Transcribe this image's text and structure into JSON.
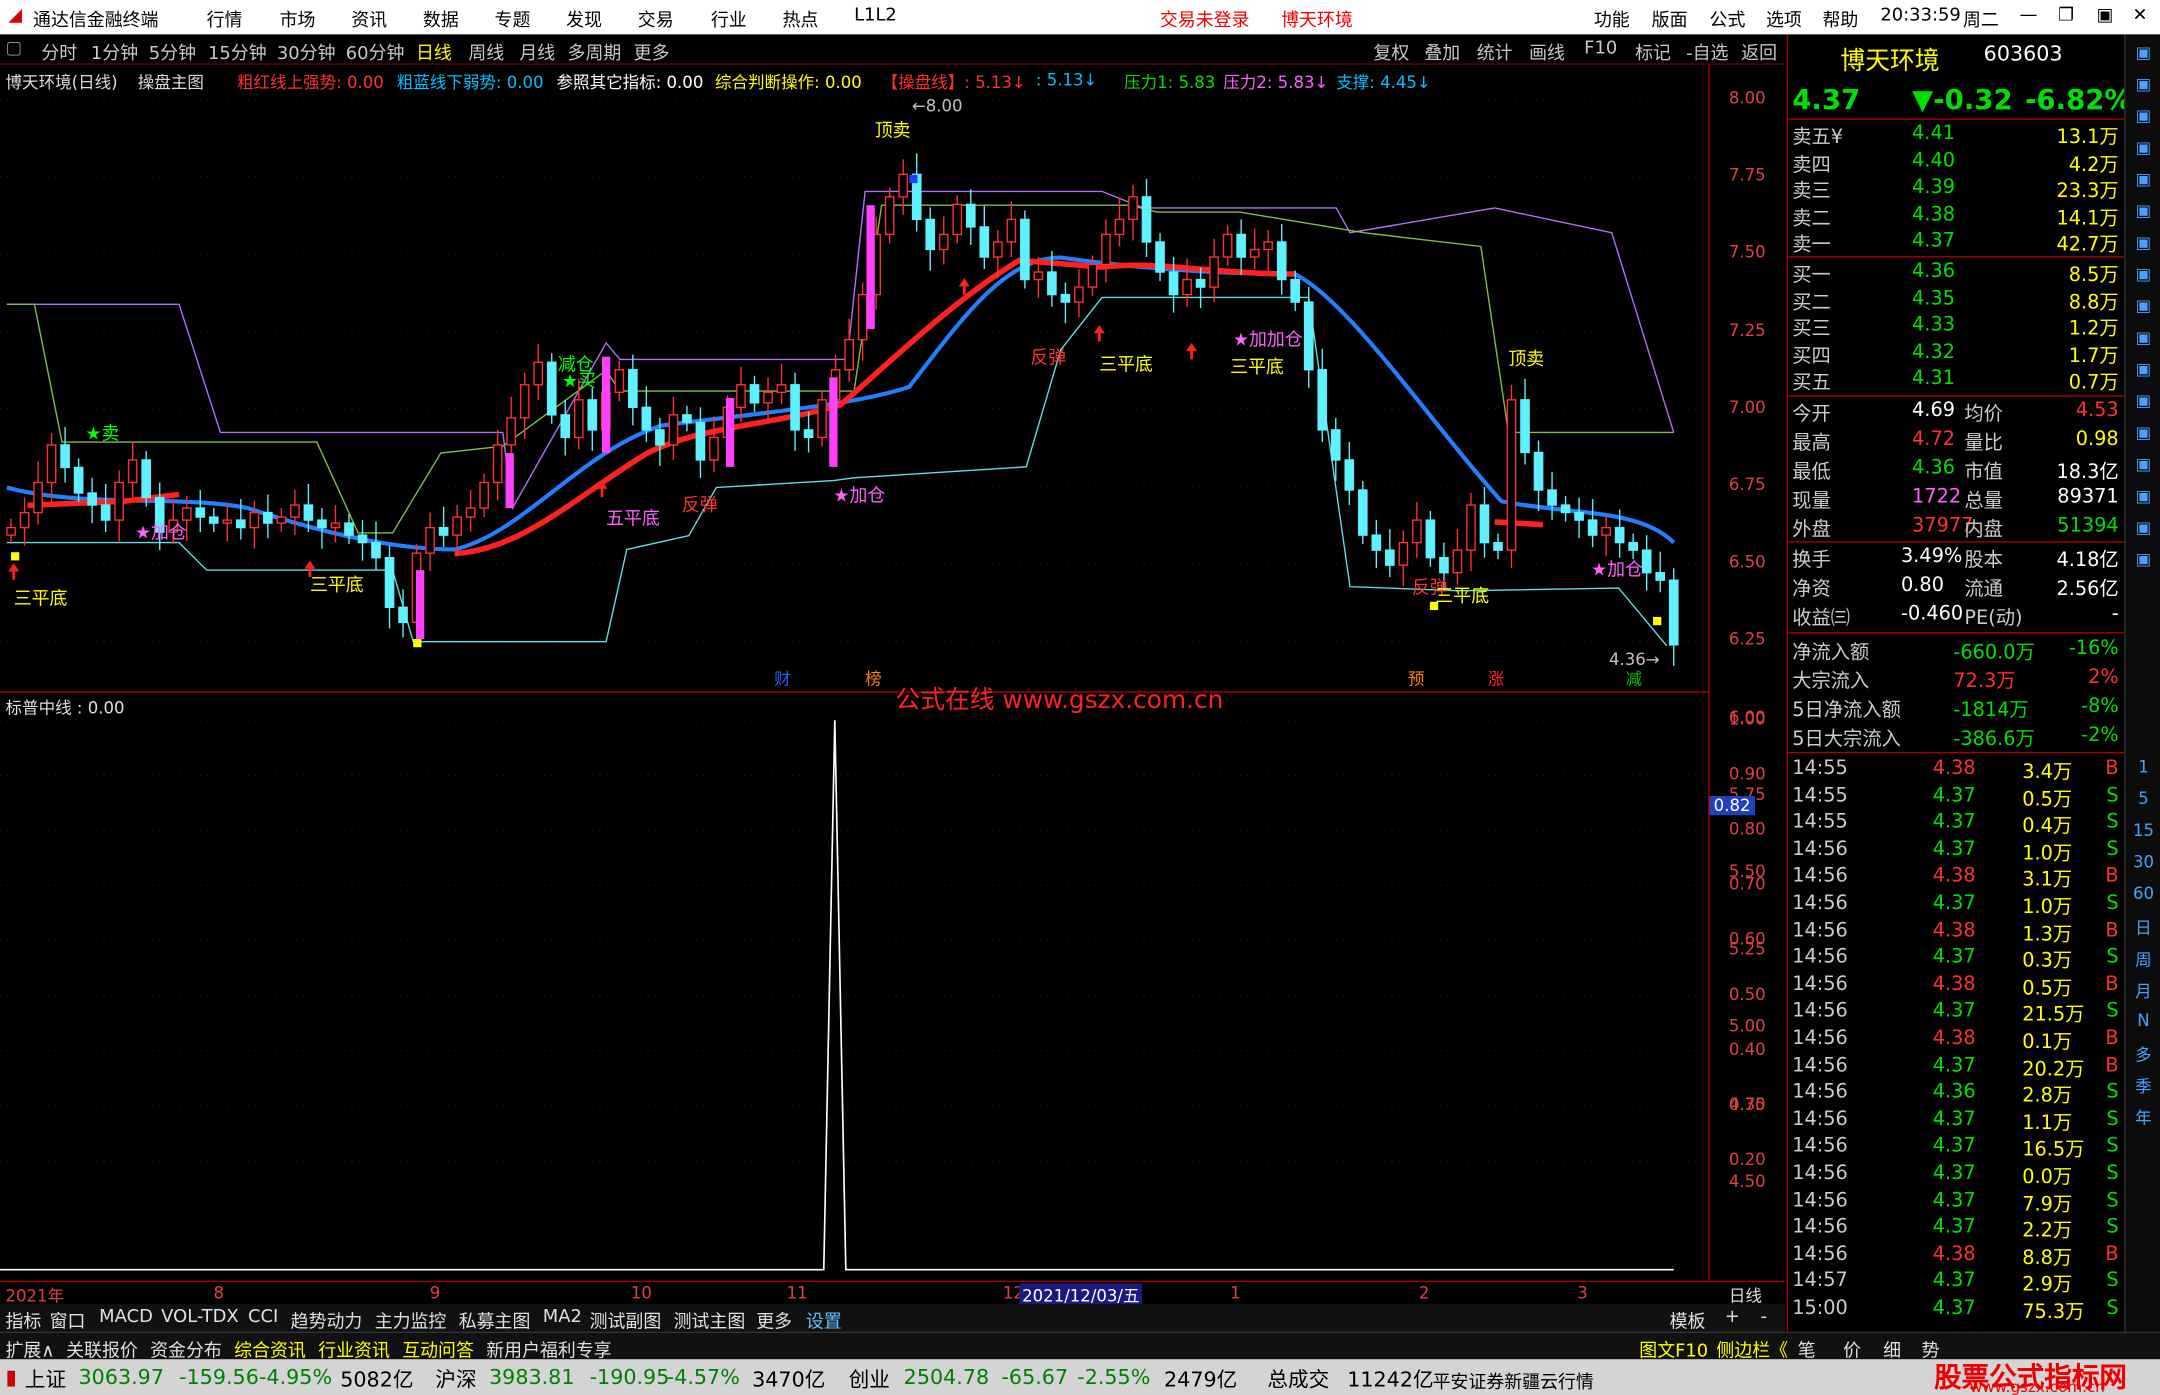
{
  "menu": {
    "app_title": "通达信金融终端",
    "items": [
      "行情",
      "市场",
      "资讯",
      "数据",
      "专题",
      "发现",
      "交易",
      "行业",
      "热点",
      "L1L2"
    ],
    "trade_status": "交易未登录",
    "stock_name": "博天环境",
    "right_items": [
      "功能",
      "版面",
      "公式",
      "选项",
      "帮助"
    ],
    "time": "20:33:59",
    "weekday": "周二"
  },
  "toolbar": {
    "periods": [
      "分时",
      "1分钟",
      "5分钟",
      "15分钟",
      "30分钟",
      "60分钟",
      "日线",
      "周线",
      "月线",
      "多周期",
      "更多"
    ],
    "active": "日线",
    "right": [
      "复权",
      "叠加",
      "统计",
      "画线",
      "F10",
      "标记",
      "-自选",
      "返回"
    ]
  },
  "info": {
    "title": "博天环境(日线)",
    "formula": "操盘主图",
    "t1": "粗红线上强势: 0.00",
    "t2": "粗蓝线下弱势: 0.00",
    "t3": "参照其它指标: 0.00",
    "t4": "综合判断操作: 0.00",
    "t5": "【操盘线】: 5.13↓",
    "t6": ": 5.13↓",
    "t7": "压力1: 5.83",
    "t8": "压力2: 5.83↓",
    "t9": "支撑: 4.45↓"
  },
  "chart_data": {
    "type": "candlestick",
    "price_axis": [
      "8.00",
      "7.75",
      "7.50",
      "7.25",
      "7.00",
      "6.75",
      "6.50",
      "6.25",
      "6.00",
      "5.75",
      "5.50",
      "5.25",
      "5.00",
      "4.75",
      "4.50"
    ],
    "ylim": [
      4.4,
      8.05
    ],
    "high_label": "8.00",
    "low_label": "4.36",
    "annotations": [
      "顶卖",
      "三平底",
      "★卖",
      "★加仓",
      "减仓",
      "★买",
      "五平底",
      "反弹",
      "★加仓",
      "三平底",
      "反弹",
      "三平底",
      "★加加仓",
      "三平底",
      "顶卖",
      "反弹",
      "三平底",
      "★加仓"
    ],
    "event_marks": [
      "财",
      "榜",
      "预",
      "涨",
      "减"
    ],
    "sub_title": "标普中线 : 0.00",
    "sub_axis": [
      "1.00",
      "0.90",
      "0.80",
      "0.70",
      "0.60",
      "0.50",
      "0.40",
      "0.30",
      "0.20"
    ],
    "sub_marker": "0.82"
  },
  "watermark": "公式在线  www.gszx.com.cn",
  "dates": {
    "d1": "2021年",
    "d2": "8",
    "d3": "9",
    "d4": "10",
    "d5": "11",
    "d6": "12",
    "cursor": "2021/12/03/五",
    "d7": "1",
    "d8": "2",
    "d9": "3",
    "period": "日线"
  },
  "tabs": [
    "指标",
    "窗口",
    "MACD",
    "VOL-TDX",
    "CCI",
    "趋势动力",
    "主力监控",
    "私募主图",
    "MA2",
    "测试副图",
    "测试主图",
    "更多",
    "设置"
  ],
  "tabs_right": [
    "模板",
    "+",
    "-"
  ],
  "tabs2": [
    "扩展∧",
    "关联报价",
    "资金分布",
    "综合资讯",
    "行业资讯",
    "互动问答",
    "新用户福利专享"
  ],
  "tabs2_right": [
    "图文F10",
    "侧边栏《",
    "笔",
    "价",
    "细",
    "势"
  ],
  "status": {
    "sh_label": "上证",
    "sh": "3063.97",
    "sh_chg": "-159.56",
    "sh_pct": "-4.95%",
    "sh_amt": "5082亿",
    "sz_label": "沪深",
    "sz": "3983.81",
    "sz_chg": "-190.95",
    "sz_pct": "-4.57%",
    "sz_amt": "3470亿",
    "cy_label": "创业",
    "cy": "2504.78",
    "cy_chg": "-65.67",
    "cy_pct": "-2.55%",
    "cy_amt": "2479亿",
    "total_label": "总成交",
    "total": "11242亿",
    "broker": "平安证券新疆云行情",
    "logo": "股票公式指标网",
    "logo_url": "www.gszx.com.cn"
  },
  "quote": {
    "name": "博天环境",
    "code": "603603",
    "price": "4.37",
    "chg": "▼-0.32",
    "pct": "-6.82%",
    "asks": [
      {
        "l": "卖五¥",
        "p": "4.41",
        "v": "13.1万"
      },
      {
        "l": "卖四",
        "p": "4.40",
        "v": "4.2万"
      },
      {
        "l": "卖三",
        "p": "4.39",
        "v": "23.3万"
      },
      {
        "l": "卖二",
        "p": "4.38",
        "v": "14.1万"
      },
      {
        "l": "卖一",
        "p": "4.37",
        "v": "42.7万"
      }
    ],
    "bids": [
      {
        "l": "买一",
        "p": "4.36",
        "v": "8.5万"
      },
      {
        "l": "买二",
        "p": "4.35",
        "v": "8.8万"
      },
      {
        "l": "买三",
        "p": "4.33",
        "v": "1.2万"
      },
      {
        "l": "买四",
        "p": "4.32",
        "v": "1.7万"
      },
      {
        "l": "买五",
        "p": "4.31",
        "v": "0.7万"
      }
    ],
    "stats": [
      [
        "今开",
        "4.69",
        "均价",
        "4.53"
      ],
      [
        "最高",
        "4.72",
        "量比",
        "0.98"
      ],
      [
        "最低",
        "4.36",
        "市值",
        "18.3亿"
      ],
      [
        "现量",
        "1722",
        "总量",
        "89371"
      ],
      [
        "外盘",
        "37977",
        "内盘",
        "51394"
      ]
    ],
    "stats2": [
      [
        "换手",
        "3.49%",
        "股本",
        "4.18亿"
      ],
      [
        "净资",
        "0.80",
        "流通",
        "2.56亿"
      ],
      [
        "收益㈢",
        "-0.460",
        "PE(动)",
        "-"
      ]
    ],
    "flows": [
      [
        "净流入额",
        "-660.0万",
        "-16%"
      ],
      [
        "大宗流入",
        "72.3万",
        "2%"
      ],
      [
        "5日净流入额",
        "-1814万",
        "-8%"
      ],
      [
        "5日大宗流入",
        "-386.6万",
        "-2%"
      ]
    ],
    "ticks": [
      [
        "14:55",
        "4.38",
        "3.4万",
        "B"
      ],
      [
        "14:55",
        "4.37",
        "0.5万",
        "S"
      ],
      [
        "14:55",
        "4.37",
        "0.4万",
        "S"
      ],
      [
        "14:56",
        "4.37",
        "1.0万",
        "S"
      ],
      [
        "14:56",
        "4.38",
        "3.1万",
        "B"
      ],
      [
        "14:56",
        "4.37",
        "1.0万",
        "S"
      ],
      [
        "14:56",
        "4.38",
        "1.3万",
        "B"
      ],
      [
        "14:56",
        "4.37",
        "0.3万",
        "S"
      ],
      [
        "14:56",
        "4.38",
        "0.5万",
        "B"
      ],
      [
        "14:56",
        "4.37",
        "21.5万",
        "S"
      ],
      [
        "14:56",
        "4.38",
        "0.1万",
        "B"
      ],
      [
        "14:56",
        "4.37",
        "20.2万",
        "B"
      ],
      [
        "14:56",
        "4.36",
        "2.8万",
        "S"
      ],
      [
        "14:56",
        "4.37",
        "1.1万",
        "S"
      ],
      [
        "14:56",
        "4.37",
        "16.5万",
        "S"
      ],
      [
        "14:56",
        "4.37",
        "0.0万",
        "S"
      ],
      [
        "14:56",
        "4.37",
        "7.9万",
        "S"
      ],
      [
        "14:56",
        "4.37",
        "2.2万",
        "S"
      ],
      [
        "14:56",
        "4.38",
        "8.8万",
        "B"
      ],
      [
        "14:57",
        "4.37",
        "2.9万",
        "S"
      ],
      [
        "15:00",
        "4.37",
        "75.3万",
        "S"
      ]
    ]
  },
  "side": [
    "1",
    "5",
    "15",
    "30",
    "60",
    "日",
    "周",
    "月",
    "N",
    "多",
    "季",
    "年"
  ]
}
